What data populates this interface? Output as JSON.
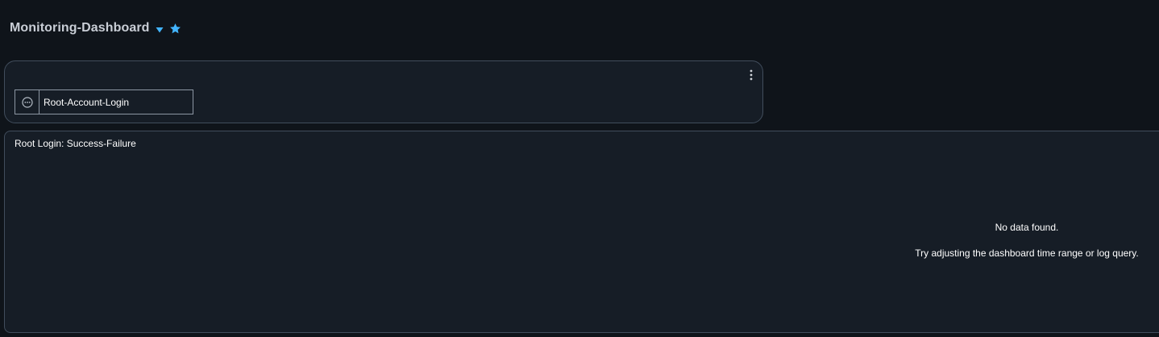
{
  "header": {
    "title": "Monitoring-Dashboard",
    "caret_icon": "caret-down-icon",
    "favorite_icon": "star-icon",
    "accent_color": "#42b4ff"
  },
  "alarm_widget": {
    "menu_icon": "more-vertical-icon",
    "alarm": {
      "status_icon": "insufficient-data-icon",
      "label": "Root-Account-Login"
    }
  },
  "log_widget": {
    "title": "Root Login: Success-Failure",
    "empty_title": "No data found.",
    "empty_hint": "Try adjusting the dashboard time range or log query."
  }
}
